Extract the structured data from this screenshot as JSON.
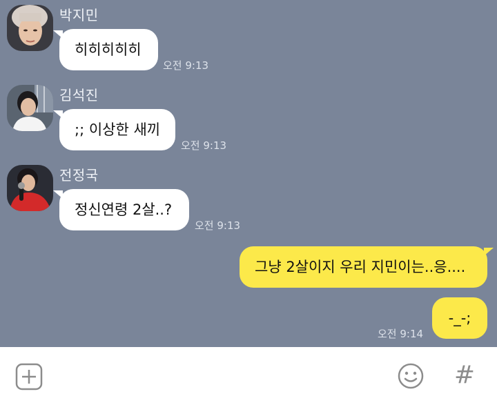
{
  "messages": [
    {
      "sender": "박지민",
      "text": "히히히히히",
      "time": "오전 9:13",
      "avatar_icon": "profile-photo-jimin"
    },
    {
      "sender": "김석진",
      "text": ";; 이상한 새끼",
      "time": "오전 9:13",
      "avatar_icon": "profile-photo-seokjin"
    },
    {
      "sender": "전정국",
      "text": "정신연령 2살..?",
      "time": "오전 9:13",
      "avatar_icon": "profile-photo-jungkook"
    },
    {
      "sender": "me",
      "text": "그냥 2살이지 우리 지민이는..응....",
      "time": ""
    },
    {
      "sender": "me",
      "text": "-_-;",
      "time": "오전 9:14"
    }
  ],
  "input_bar": {
    "attach_icon": "plus-square-icon",
    "emoji_icon": "smiley-icon",
    "hashtag_icon": "hash-icon",
    "hashtag_label": "#"
  },
  "colors": {
    "background": "#7a8599",
    "incoming_bubble": "#ffffff",
    "outgoing_bubble": "#fce94a",
    "input_bar": "#ffffff"
  }
}
